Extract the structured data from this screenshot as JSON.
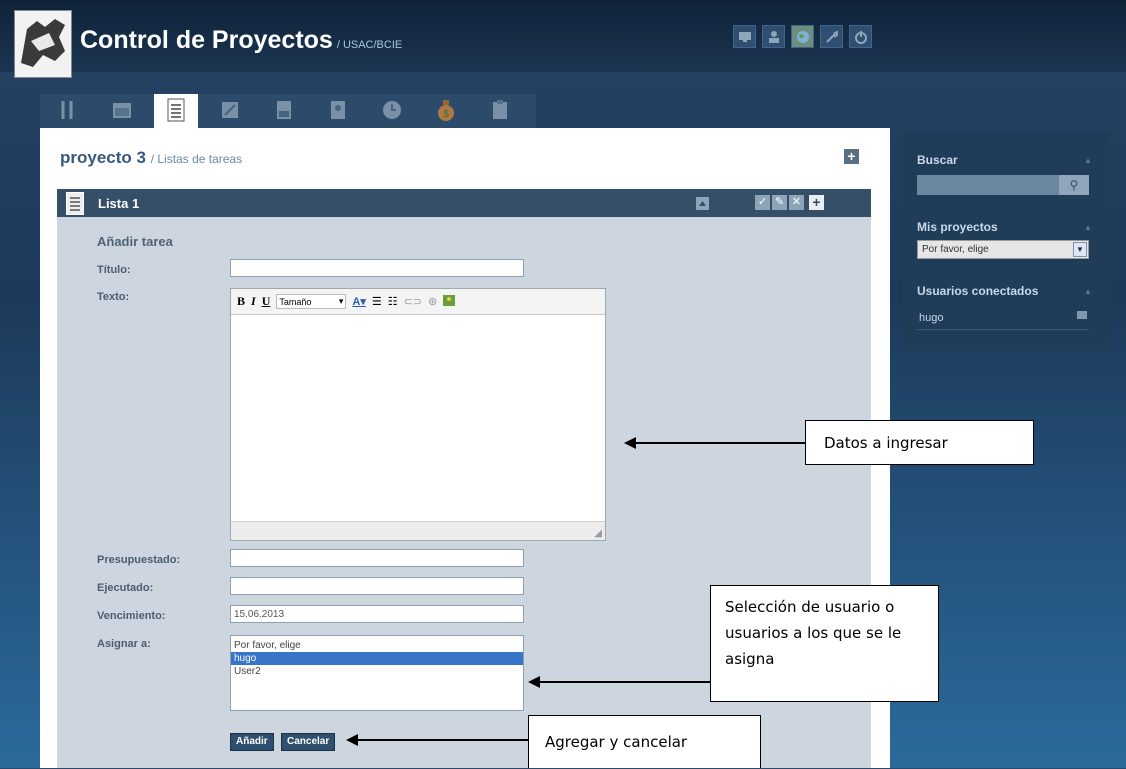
{
  "app": {
    "title": "Control de Proyectos",
    "subtitle": "/ USAC/BCIE"
  },
  "page": {
    "title": "proyecto 3",
    "subtitle": "/ Listas de tareas"
  },
  "list": {
    "title": "Lista 1"
  },
  "form": {
    "title": "Añadir tarea",
    "titulo_label": "Título:",
    "texto_label": "Texto:",
    "presupuestado_label": "Presupuestado:",
    "ejecutado_label": "Ejecutado:",
    "vencimiento_label": "Vencimiento:",
    "vencimiento_value": "15.06.2013",
    "asignar_label": "Asignar a:",
    "assign_options": [
      "Por favor, elige",
      "hugo",
      "User2"
    ],
    "assign_selected": "hugo",
    "add_button": "Añadir",
    "cancel_button": "Cancelar"
  },
  "editor": {
    "bold": "B",
    "italic": "I",
    "underline": "U",
    "font_size_placeholder": "Tamaño",
    "font_color": "A"
  },
  "sidebar": {
    "search_title": "Buscar",
    "projects_title": "Mis proyectos",
    "projects_selected": "Por favor, elige",
    "users_title": "Usuarios conectados",
    "users": [
      "hugo"
    ]
  },
  "annotations": {
    "data": "Datos a ingresar",
    "users_line1": "Selección de usuario o",
    "users_line2": "usuarios a los que se le",
    "users_line3": "asigna",
    "buttons": "Agregar y cancelar"
  },
  "icons": {
    "top_nav": [
      "monitor-icon",
      "user-icon",
      "globe-icon",
      "wrench-icon",
      "power-icon"
    ],
    "tabs": [
      "tools-icon",
      "calendar-icon",
      "checklist-icon",
      "edit-icon",
      "document-icon",
      "id-card-icon",
      "clock-icon",
      "money-bag-icon",
      "clipboard-icon"
    ]
  },
  "colors": {
    "header": "#1b3552",
    "panel_header": "#354f68",
    "form_bg": "#cdd6de",
    "selected": "#3874c8"
  }
}
